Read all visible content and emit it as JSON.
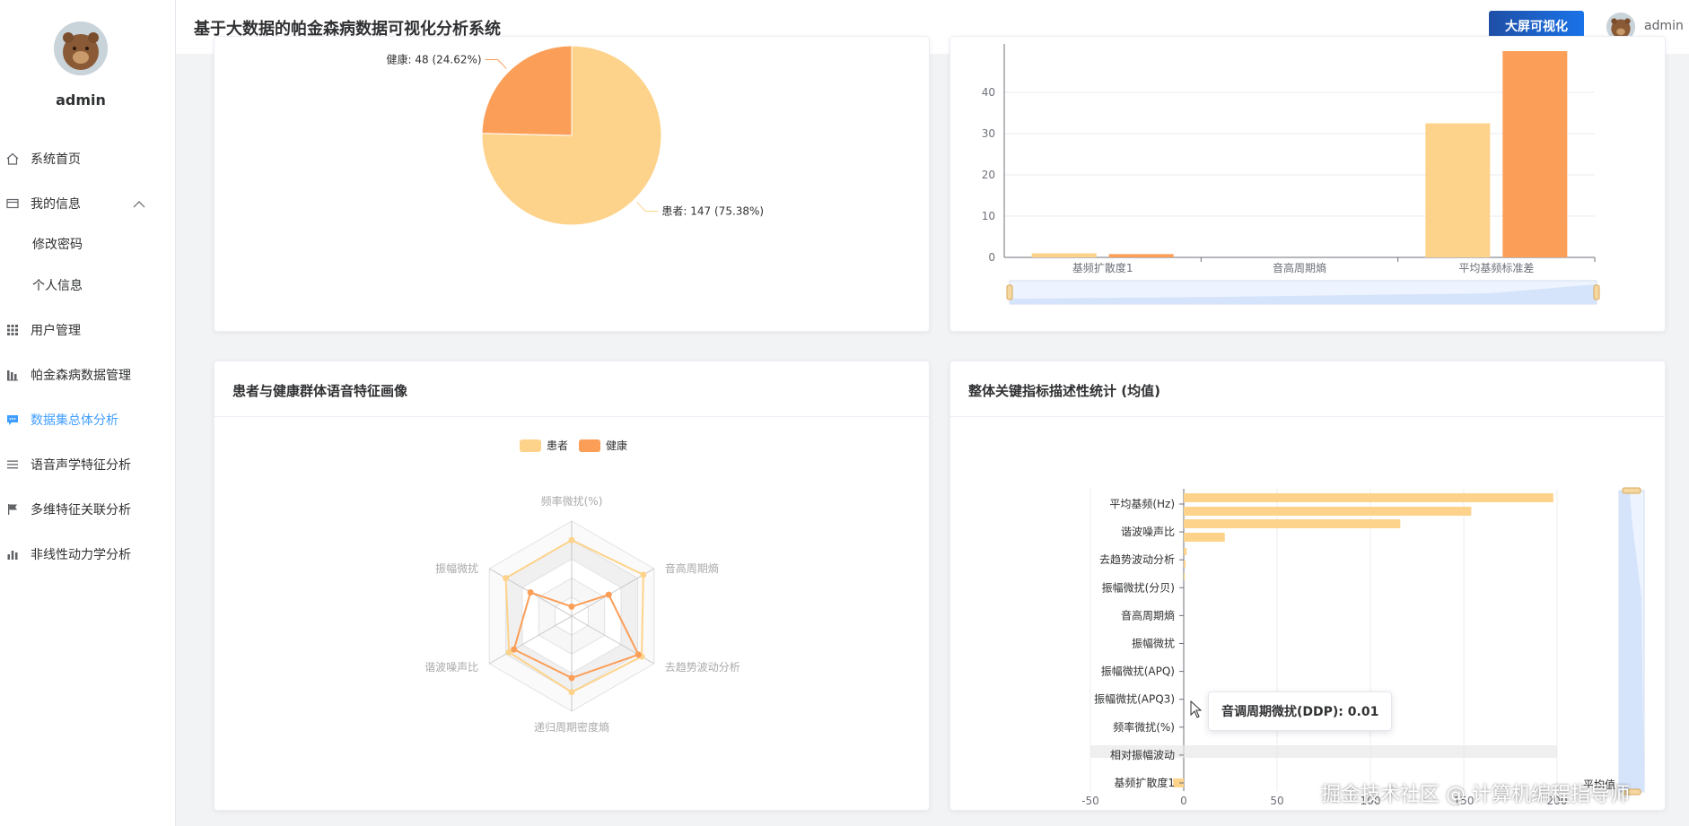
{
  "app": {
    "title": "基于大数据的帕金森病数据可视化分析系统"
  },
  "header": {
    "big_screen_label": "大屏可视化",
    "user_name": "admin"
  },
  "sidebar": {
    "user_name": "admin",
    "items": [
      {
        "label": "系统首页",
        "icon": "home-icon"
      },
      {
        "label": "我的信息",
        "icon": "id-card-icon"
      },
      {
        "label": "修改密码",
        "icon": ""
      },
      {
        "label": "个人信息",
        "icon": ""
      },
      {
        "label": "用户管理",
        "icon": "grid-icon"
      },
      {
        "label": "帕金森病数据管理",
        "icon": "bar-chart-icon"
      },
      {
        "label": "数据集总体分析",
        "icon": "message-icon"
      },
      {
        "label": "语音声学特征分析",
        "icon": "list-icon"
      },
      {
        "label": "多维特征关联分析",
        "icon": "flag-icon"
      },
      {
        "label": "非线性动力学分析",
        "icon": "stats-icon"
      }
    ],
    "active_color": "#409eff"
  },
  "cards": {
    "radar_title": "患者与健康群体语音特征画像",
    "desc_title": "整体关键指标描述性统计 (均值)"
  },
  "tooltip": {
    "label": "音调周期微扰(DDP): 0.01"
  },
  "watermark": "掘金技术社区 @ 计算机编程指导师",
  "colors": {
    "patient": "#fdd38b",
    "healthy": "#fb9e58",
    "primary": "#1a73e8"
  },
  "chart_data": [
    {
      "type": "pie",
      "slices": [
        {
          "name": "患者",
          "value": 147,
          "percent": 75.38,
          "label": "患者: 147 (75.38%)"
        },
        {
          "name": "健康",
          "value": 48,
          "percent": 24.62,
          "label": "健康: 48 (24.62%)"
        }
      ]
    },
    {
      "type": "bar",
      "categories": [
        "基频扩散度1",
        "音高周期熵",
        "平均基频标准差"
      ],
      "yticks": [
        "0",
        "10",
        "20",
        "30",
        "40"
      ],
      "ylim": [
        0,
        50
      ],
      "series": [
        {
          "values": [
            1,
            0,
            32.5
          ]
        },
        {
          "values": [
            0.8,
            0,
            50
          ]
        }
      ]
    },
    {
      "type": "radar",
      "legend": [
        "患者",
        "健康"
      ],
      "indicators": [
        "频率微扰(%)",
        "音高周期熵",
        "去趋势波动分析",
        "递归周期密度熵",
        "谐波噪声比",
        "振幅微扰"
      ],
      "series": [
        {
          "name": "患者",
          "values": [
            0.8,
            0.87,
            0.85,
            0.8,
            0.76,
            0.8
          ]
        },
        {
          "name": "健康",
          "values": [
            0.1,
            0.45,
            0.81,
            0.65,
            0.7,
            0.5
          ]
        }
      ]
    },
    {
      "type": "bar",
      "orientation": "horizontal",
      "categories": [
        "平均基频(Hz)",
        "谐波噪声比",
        "去趋势波动分析",
        "振幅微扰(分贝)",
        "音高周期熵",
        "振幅微扰",
        "振幅微扰(APQ)",
        "振幅微扰(APQ3)",
        "音调周期微扰(DDP)",
        "频率微扰(%)",
        "相对振幅波动",
        "基频扩散度1"
      ],
      "ytick_labels": [
        "平均基频(Hz)",
        "谐波噪声比",
        "去趋势波动分析",
        "振幅微扰(分贝)",
        "音高周期熵",
        "振幅微扰",
        "振幅微扰(APQ)",
        "振幅微扰(APQ3)",
        "频率微扰(%)",
        "相对振幅波动",
        "基频扩散度1"
      ],
      "xticks": [
        "-50",
        "0",
        "50",
        "100",
        "150",
        "200"
      ],
      "xlim": [
        -50,
        200
      ],
      "values": [
        198,
        154,
        116,
        22,
        2,
        0.3,
        0.03,
        0.03,
        0.01,
        0.01,
        0.01,
        -5.7
      ],
      "extra_bars": [],
      "series_label": "平均值"
    }
  ]
}
